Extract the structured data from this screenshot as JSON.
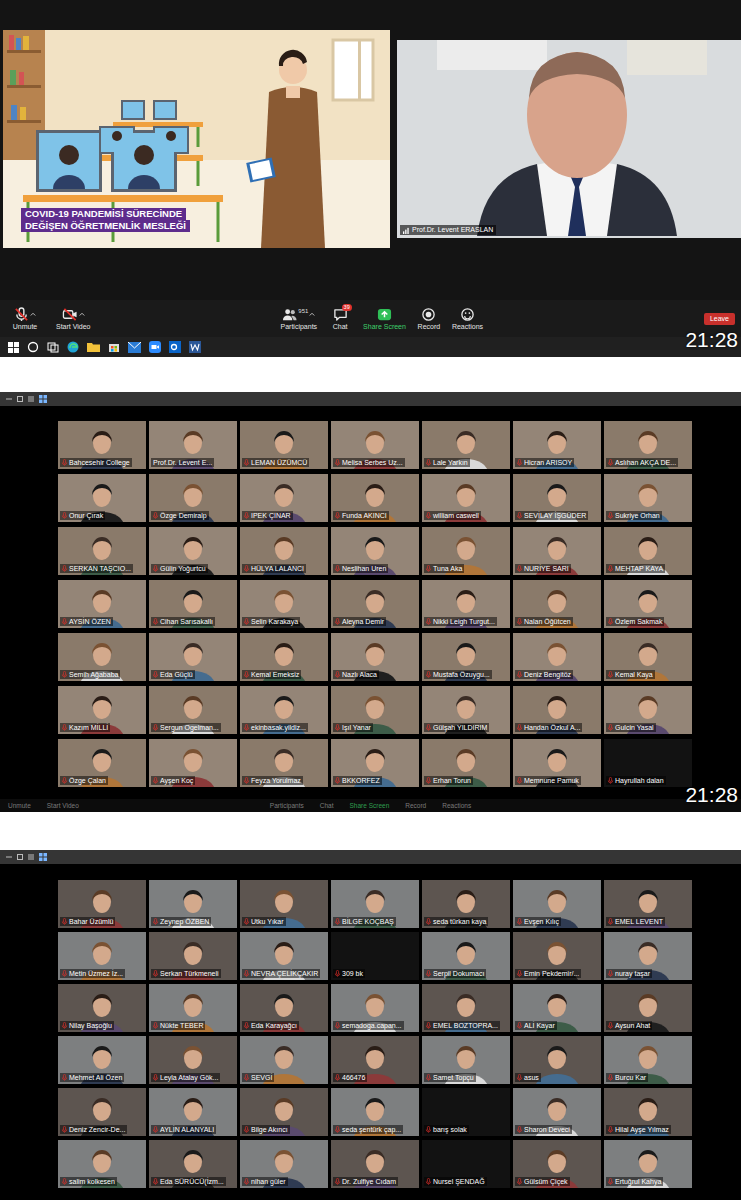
{
  "speaker_view": {
    "slide": {
      "title": [
        "COVID-19 PANDEMİSİ SÜRECİNDE",
        "DEĞİŞEN ÖĞRETMENLİK MESLEĞİ"
      ]
    },
    "speaker": {
      "name": "Prof.Dr. Levent ERASLAN"
    },
    "toolbar": [
      {
        "label": "Unmute",
        "kind": "mic",
        "muted": true
      },
      {
        "label": "Start Video",
        "kind": "video",
        "muted": true
      },
      {
        "label": "Participants",
        "kind": "participants",
        "count": "951"
      },
      {
        "label": "Chat",
        "kind": "chat",
        "badge": "39"
      },
      {
        "label": "Share Screen",
        "kind": "share"
      },
      {
        "label": "Record",
        "kind": "record"
      },
      {
        "label": "Reactions",
        "kind": "reactions"
      }
    ],
    "leave": "Leave",
    "clock": "21:28"
  },
  "galleries": [
    {
      "clock": "21:28",
      "toolbar": [
        {
          "label": "Unmute",
          "kind": "mic"
        },
        {
          "label": "Start Video",
          "kind": "video"
        },
        {
          "label": "Participants",
          "kind": "participants"
        },
        {
          "label": "Chat",
          "kind": "chat"
        },
        {
          "label": "Share Screen",
          "kind": "share"
        },
        {
          "label": "Record",
          "kind": "record"
        },
        {
          "label": "Reactions",
          "kind": "reactions"
        }
      ],
      "tiles": [
        {
          "name": "Bahcesehir College",
          "muted": true,
          "video": true,
          "speaking": false
        },
        {
          "name": "Prof.Dr. Levent E...",
          "muted": false,
          "video": true,
          "speaking": true
        },
        {
          "name": "LEMAN ÜZÜMCÜ",
          "muted": true,
          "video": true,
          "speaking": false
        },
        {
          "name": "Melisa Serbes Uz...",
          "muted": true,
          "video": true,
          "speaking": false
        },
        {
          "name": "Lale Yarkın",
          "muted": true,
          "video": true,
          "speaking": false
        },
        {
          "name": "Hicran ARISOY",
          "muted": true,
          "video": true,
          "speaking": false
        },
        {
          "name": "Aslıhan AKÇA DE...",
          "muted": true,
          "video": true,
          "speaking": false
        },
        {
          "name": "Onur Çırak",
          "muted": true,
          "video": true,
          "speaking": false
        },
        {
          "name": "Özge Demiralp",
          "muted": true,
          "video": true,
          "speaking": false
        },
        {
          "name": "IPEK ÇINAR",
          "muted": true,
          "video": true,
          "speaking": false
        },
        {
          "name": "Funda AKINCI",
          "muted": true,
          "video": true,
          "speaking": false
        },
        {
          "name": "william caswell",
          "muted": true,
          "video": true,
          "speaking": false
        },
        {
          "name": "SEVİLAY İŞGÜDER",
          "muted": true,
          "video": true,
          "speaking": false
        },
        {
          "name": "Sukriye Orhan",
          "muted": true,
          "video": true,
          "speaking": false
        },
        {
          "name": "SERKAN TAŞCIO...",
          "muted": true,
          "video": true,
          "speaking": false
        },
        {
          "name": "Gülin Yoğurtcu",
          "muted": true,
          "video": true,
          "speaking": false
        },
        {
          "name": "HÜLYA LALANCI",
          "muted": true,
          "video": true,
          "speaking": false
        },
        {
          "name": "Neslihan Uren",
          "muted": true,
          "video": true,
          "speaking": false
        },
        {
          "name": "Tuna Aka",
          "muted": true,
          "video": true,
          "speaking": false
        },
        {
          "name": "NURİYE SARI",
          "muted": true,
          "video": true,
          "speaking": false
        },
        {
          "name": "MEHTAP KAYA",
          "muted": true,
          "video": true,
          "speaking": false
        },
        {
          "name": "AYSİN ÖZEN",
          "muted": true,
          "video": true,
          "speaking": false
        },
        {
          "name": "Cihan Sarısakallı",
          "muted": true,
          "video": true,
          "speaking": false
        },
        {
          "name": "Selin Karakaya",
          "muted": true,
          "video": true,
          "speaking": false
        },
        {
          "name": "Aleyna Demir",
          "muted": true,
          "video": true,
          "speaking": false
        },
        {
          "name": "Nikki Leigh Turgut...",
          "muted": true,
          "video": true,
          "speaking": false
        },
        {
          "name": "Nalan Öğütcen",
          "muted": true,
          "video": true,
          "speaking": false
        },
        {
          "name": "Özlem Sakmak",
          "muted": true,
          "video": true,
          "speaking": false
        },
        {
          "name": "Semih Ağababa",
          "muted": true,
          "video": true,
          "speaking": false
        },
        {
          "name": "Eda Güçlü",
          "muted": true,
          "video": true,
          "speaking": false
        },
        {
          "name": "Kemal Emeksiz",
          "muted": true,
          "video": true,
          "speaking": false
        },
        {
          "name": "Nazlı Alaca",
          "muted": true,
          "video": true,
          "speaking": false
        },
        {
          "name": "Mustafa Özuygu...",
          "muted": true,
          "video": true,
          "speaking": false
        },
        {
          "name": "Deniz Bengitöz",
          "muted": true,
          "video": true,
          "speaking": false
        },
        {
          "name": "Kemal Kaya",
          "muted": true,
          "video": true,
          "speaking": false
        },
        {
          "name": "Kazım MİLLİ",
          "muted": true,
          "video": true,
          "speaking": false
        },
        {
          "name": "Sergun Ogelman...",
          "muted": true,
          "video": true,
          "speaking": false
        },
        {
          "name": "ekinbasak.yildiz...",
          "muted": true,
          "video": true,
          "speaking": false
        },
        {
          "name": "Işıl Yanar",
          "muted": true,
          "video": true,
          "speaking": false
        },
        {
          "name": "Gülşah YILDIRIM",
          "muted": true,
          "video": true,
          "speaking": false
        },
        {
          "name": "Handan Özkul A...",
          "muted": true,
          "video": true,
          "speaking": false
        },
        {
          "name": "Gulcin Yasal",
          "muted": true,
          "video": true,
          "speaking": false
        },
        {
          "name": "Özge Çalan",
          "muted": true,
          "video": true,
          "speaking": false
        },
        {
          "name": "Ayşen Koç",
          "muted": true,
          "video": true,
          "speaking": false
        },
        {
          "name": "Feyza Yorulmaz",
          "muted": true,
          "video": true,
          "speaking": false
        },
        {
          "name": "BKKORFEZ",
          "muted": true,
          "video": true,
          "speaking": false
        },
        {
          "name": "Erhan Torun",
          "muted": true,
          "video": true,
          "speaking": false
        },
        {
          "name": "Memnune Pamuk",
          "muted": true,
          "video": true,
          "speaking": false
        },
        {
          "name": "Hayrullah dalan",
          "muted": true,
          "video": false,
          "speaking": false
        }
      ]
    },
    {
      "tiles": [
        {
          "name": "Bahar Üzümlü",
          "muted": true,
          "video": true,
          "speaking": false
        },
        {
          "name": "Zeynep ÖZBEN",
          "muted": true,
          "video": true,
          "speaking": false
        },
        {
          "name": "Utku Yıkar",
          "muted": true,
          "video": true,
          "speaking": false
        },
        {
          "name": "BİLGE KOÇBAŞ",
          "muted": true,
          "video": true,
          "speaking": false
        },
        {
          "name": "seda türkan kaya",
          "muted": true,
          "video": true,
          "speaking": false
        },
        {
          "name": "Evşen Kılıç",
          "muted": true,
          "video": true,
          "speaking": false
        },
        {
          "name": "EMEL LEVENT",
          "muted": true,
          "video": true,
          "speaking": false
        },
        {
          "name": "Metin Üzmez İz...",
          "muted": true,
          "video": true,
          "speaking": false
        },
        {
          "name": "Serkan Türkmeneli",
          "muted": true,
          "video": true,
          "speaking": false
        },
        {
          "name": "NEVRA ÇELİKÇAKIR",
          "muted": true,
          "video": true,
          "speaking": false
        },
        {
          "name": "309 bk",
          "muted": true,
          "video": false,
          "speaking": false
        },
        {
          "name": "Serpil Dokumacı",
          "muted": true,
          "video": true,
          "speaking": false
        },
        {
          "name": "Emin Pekdemir/...",
          "muted": true,
          "video": true,
          "speaking": false
        },
        {
          "name": "nuray taşar",
          "muted": true,
          "video": true,
          "speaking": false
        },
        {
          "name": "Nilay Başoğlu",
          "muted": true,
          "video": true,
          "speaking": false
        },
        {
          "name": "Nükte TEBER",
          "muted": true,
          "video": true,
          "speaking": false
        },
        {
          "name": "Eda Karayağcı",
          "muted": true,
          "video": true,
          "speaking": false
        },
        {
          "name": "semadoga.capan...",
          "muted": true,
          "video": true,
          "speaking": false
        },
        {
          "name": "EMEL BOZTOPRA...",
          "muted": true,
          "video": true,
          "speaking": false
        },
        {
          "name": "ALİ Kayar",
          "muted": true,
          "video": true,
          "speaking": false
        },
        {
          "name": "Aysun Ahat",
          "muted": true,
          "video": true,
          "speaking": false
        },
        {
          "name": "Mehmet Ali Özen",
          "muted": true,
          "video": true,
          "speaking": false
        },
        {
          "name": "Leyla Atalay Gök...",
          "muted": true,
          "video": true,
          "speaking": false
        },
        {
          "name": "SEVGİ",
          "muted": true,
          "video": true,
          "speaking": false
        },
        {
          "name": "466476",
          "muted": true,
          "video": true,
          "speaking": false
        },
        {
          "name": "Samet Topçu",
          "muted": true,
          "video": true,
          "speaking": false
        },
        {
          "name": "asus",
          "muted": true,
          "video": true,
          "speaking": false
        },
        {
          "name": "Burcu Kar",
          "muted": true,
          "video": true,
          "speaking": false
        },
        {
          "name": "Deniz Zencir-De...",
          "muted": true,
          "video": true,
          "speaking": false
        },
        {
          "name": "AYLİN ALANYALI",
          "muted": true,
          "video": true,
          "speaking": false
        },
        {
          "name": "Bilge Akıncı",
          "muted": true,
          "video": true,
          "speaking": false
        },
        {
          "name": "seda şentürk çap...",
          "muted": true,
          "video": true,
          "speaking": false
        },
        {
          "name": "barış solak",
          "muted": true,
          "video": false,
          "speaking": false
        },
        {
          "name": "Sharon Deveci",
          "muted": true,
          "video": true,
          "speaking": false
        },
        {
          "name": "Hilal Ayşe Yılmaz",
          "muted": true,
          "video": true,
          "speaking": false
        },
        {
          "name": "salim kolkesen",
          "muted": true,
          "video": true,
          "speaking": false
        },
        {
          "name": "Eda SÜRÜCÜ(İzm...",
          "muted": true,
          "video": true,
          "speaking": false
        },
        {
          "name": "nihan güler",
          "muted": true,
          "video": true,
          "speaking": false
        },
        {
          "name": "Dr. Zulfiye Cıdam",
          "muted": true,
          "video": true,
          "speaking": false
        },
        {
          "name": "Nursel ŞENDAĞ",
          "muted": true,
          "video": false,
          "speaking": false
        },
        {
          "name": "Gülsüm Çiçek",
          "muted": true,
          "video": true,
          "speaking": false
        },
        {
          "name": "Ertuğrul Kahya",
          "muted": true,
          "video": true,
          "speaking": false
        }
      ]
    }
  ]
}
